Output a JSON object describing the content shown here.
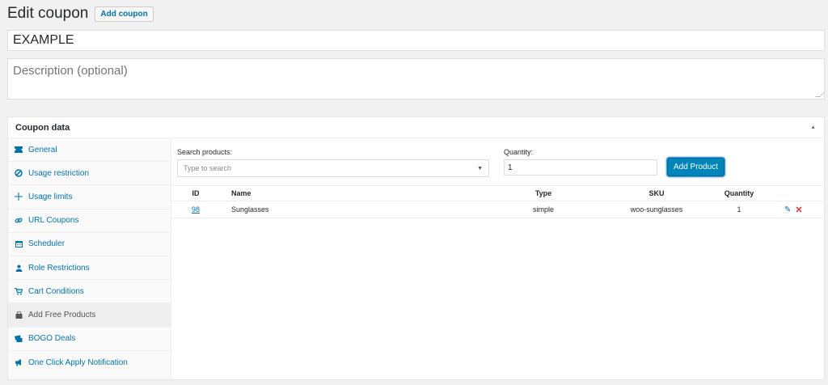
{
  "header": {
    "title": "Edit coupon",
    "add_button": "Add coupon"
  },
  "coupon": {
    "code": "EXAMPLE",
    "description_placeholder": "Description (optional)"
  },
  "coupon_data": {
    "title": "Coupon data",
    "toggle_icon": "triangle-up-icon",
    "sidebar": [
      {
        "label": "General",
        "icon": "ticket-icon"
      },
      {
        "label": "Usage restriction",
        "icon": "prohibited-icon"
      },
      {
        "label": "Usage limits",
        "icon": "crosshair-icon"
      },
      {
        "label": "URL Coupons",
        "icon": "link-icon"
      },
      {
        "label": "Scheduler",
        "icon": "calendar-icon"
      },
      {
        "label": "Role Restrictions",
        "icon": "user-icon"
      },
      {
        "label": "Cart Conditions",
        "icon": "cart-icon"
      },
      {
        "label": "Add Free Products",
        "icon": "bag-icon",
        "active": true
      },
      {
        "label": "BOGO Deals",
        "icon": "tickets-icon"
      },
      {
        "label": "One Click Apply Notification",
        "icon": "megaphone-icon"
      }
    ],
    "free_products": {
      "search_label": "Search products:",
      "search_placeholder": "Type to search",
      "quantity_label": "Quantity:",
      "quantity_value": "1",
      "add_button": "Add Product",
      "columns": [
        "ID",
        "Name",
        "Type",
        "SKU",
        "Quantity"
      ],
      "rows": [
        {
          "id": "98",
          "name": "Sunglasses",
          "type": "simple",
          "sku": "woo-sunglasses",
          "quantity": "1"
        }
      ]
    }
  },
  "colors": {
    "link": "#0073aa",
    "primary_button": "#0085ba",
    "delete": "#dc3232"
  }
}
